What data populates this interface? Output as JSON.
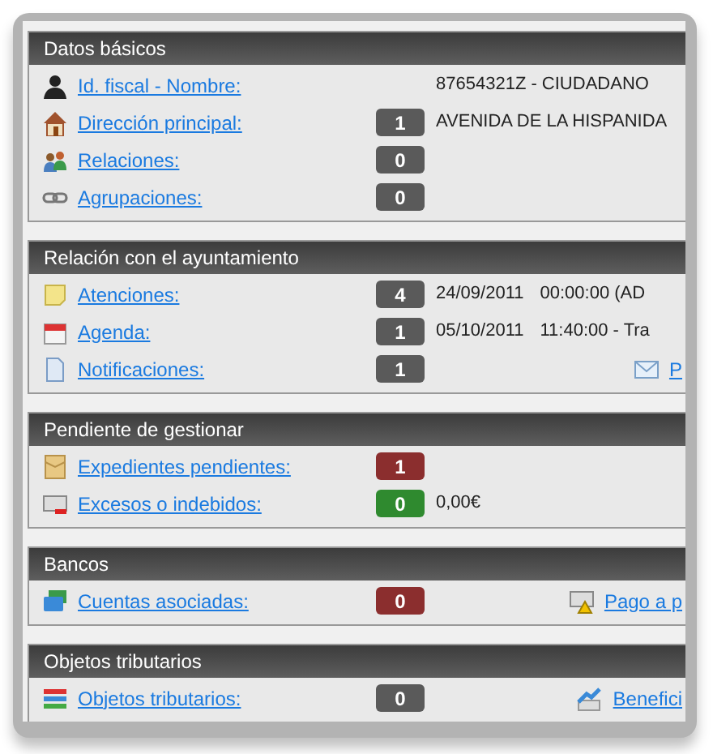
{
  "sections": [
    {
      "title": "Datos básicos",
      "rows": [
        {
          "label": "Id. fiscal - Nombre:",
          "value": "87654321Z - CIUDADANO"
        },
        {
          "label": "Dirección principal:",
          "count": "1",
          "color": "#5a5a5a",
          "value": "AVENIDA DE LA HISPANIDA"
        },
        {
          "label": "Relaciones:",
          "count": "0",
          "color": "#5a5a5a"
        },
        {
          "label": "Agrupaciones:",
          "count": "0",
          "color": "#5a5a5a"
        }
      ]
    },
    {
      "title": "Relación con el ayuntamiento",
      "rows": [
        {
          "label": "Atenciones:",
          "count": "4",
          "color": "#5a5a5a",
          "value": "24/09/2011",
          "value_2": "00:00:00 (AD"
        },
        {
          "label": "Agenda:",
          "count": "1",
          "color": "#5a5a5a",
          "value": "05/10/2011",
          "value_2": "11:40:00 - Tra"
        },
        {
          "label": "Notificaciones:",
          "count": "1",
          "color": "#5a5a5a",
          "link": "P"
        }
      ]
    },
    {
      "title": "Pendiente de gestionar",
      "rows": [
        {
          "label": "Expedientes pendientes:",
          "count": "1",
          "color": "#8b2e2e"
        },
        {
          "label": "Excesos o indebidos:",
          "count": "0",
          "color": "#2f8a2f",
          "value": "0,00€"
        }
      ]
    },
    {
      "title": "Bancos",
      "rows": [
        {
          "label": "Cuentas asociadas:",
          "count": "0",
          "color": "#8b2e2e",
          "link": "Pago a p"
        }
      ]
    },
    {
      "title": "Objetos tributarios",
      "rows": [
        {
          "label": "Objetos tributarios:",
          "count": "0",
          "color": "#5a5a5a",
          "link": "Benefici"
        }
      ]
    }
  ]
}
